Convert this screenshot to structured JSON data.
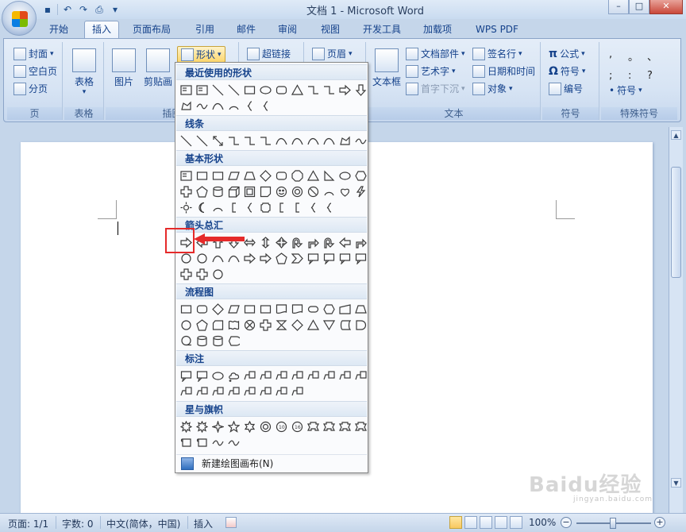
{
  "window": {
    "title": "文档 1 - Microsoft Word"
  },
  "tabs": [
    "开始",
    "插入",
    "页面布局",
    "引用",
    "邮件",
    "审阅",
    "视图",
    "开发工具",
    "加载项",
    "WPS PDF"
  ],
  "active_tab": "插入",
  "ribbon": {
    "page_group": {
      "label": "页",
      "items": [
        "封面",
        "空白页",
        "分页"
      ]
    },
    "table_group": {
      "label": "表格",
      "button": "表格"
    },
    "illus_group": {
      "label": "插图",
      "picture": "图片",
      "clipart": "剪贴画",
      "shapes": "形状"
    },
    "links_group": {
      "hyperlink": "超链接"
    },
    "header_group": {
      "header": "页眉"
    },
    "text_group": {
      "label": "文本",
      "textbox": "文本框",
      "parts": "文档部件",
      "wordart": "艺术字",
      "dropcap": "首字下沉",
      "signature": "签名行",
      "datetime": "日期和时间",
      "object": "对象"
    },
    "symbol_group": {
      "label": "符号",
      "equation": "公式",
      "symbol": "符号",
      "number": "编号"
    },
    "special_group": {
      "label": "特殊符号",
      "symbol": "符号",
      "chars": [
        ",",
        "。",
        "、",
        ";",
        ":",
        "?"
      ]
    }
  },
  "shapes_menu": {
    "categories": [
      "最近使用的形状",
      "线条",
      "基本形状",
      "箭头总汇",
      "流程图",
      "标注",
      "星与旗帜"
    ],
    "new_canvas": "新建绘图画布(N)"
  },
  "status": {
    "page": "页面: 1/1",
    "words": "字数: 0",
    "lang": "中文(简体，中国)",
    "mode": "插入",
    "zoom": "100%"
  },
  "watermark": {
    "brand": "Baidu经验",
    "url": "jingyan.baidu.com"
  }
}
